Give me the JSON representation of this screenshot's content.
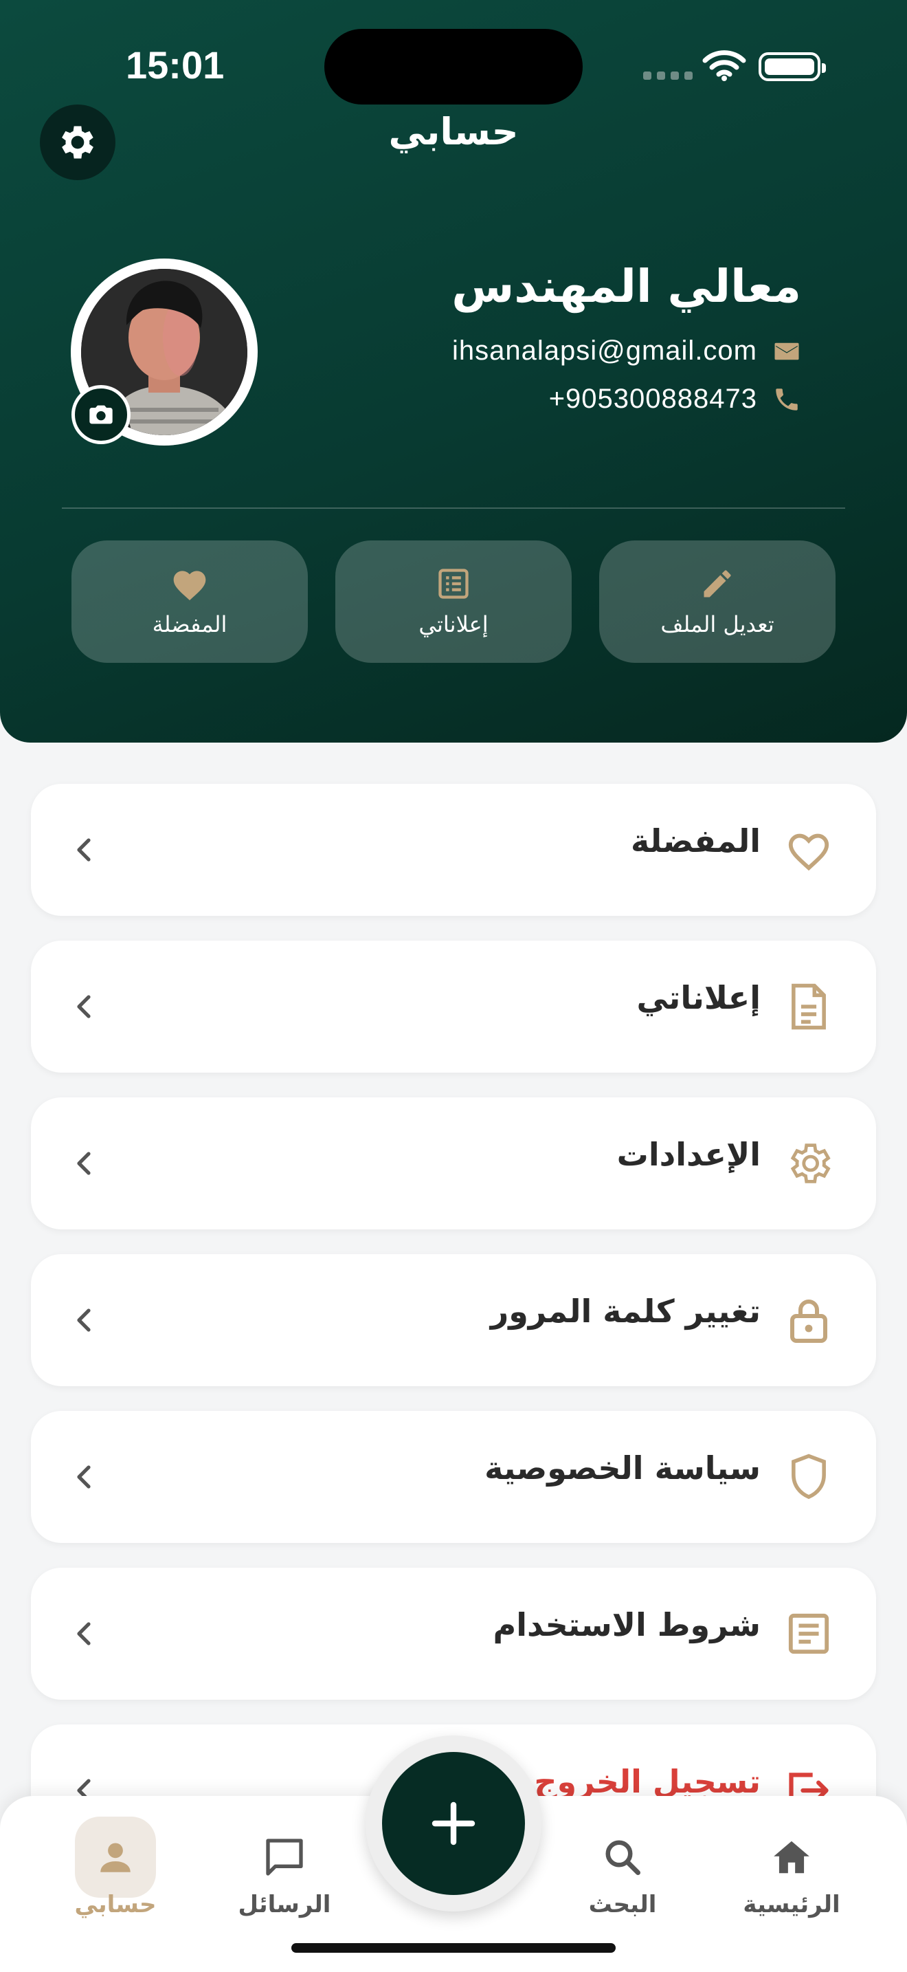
{
  "status_bar": {
    "time": "15:01"
  },
  "header": {
    "title": "حسابي"
  },
  "profile": {
    "name": "معالي المهندس",
    "email": "ihsanalapsi@gmail.com",
    "phone": "+905300888473"
  },
  "quick_actions": [
    {
      "label": "المفضلة",
      "icon": "heart-icon"
    },
    {
      "label": "إعلاناتي",
      "icon": "list-icon"
    },
    {
      "label": "تعديل الملف",
      "icon": "pencil-icon"
    }
  ],
  "menu": [
    {
      "label": "المفضلة",
      "icon": "heart-outline-icon"
    },
    {
      "label": "إعلاناتي",
      "icon": "document-icon"
    },
    {
      "label": "الإعدادات",
      "icon": "gear-icon"
    },
    {
      "label": "تغيير كلمة المرور",
      "icon": "lock-icon"
    },
    {
      "label": "سياسة الخصوصية",
      "icon": "shield-icon"
    },
    {
      "label": "شروط الاستخدام",
      "icon": "terms-icon"
    },
    {
      "label": "تسجيل الخروج",
      "icon": "logout-icon"
    }
  ],
  "bottom_nav": [
    {
      "label": "حسابي",
      "icon": "person-icon",
      "active": true
    },
    {
      "label": "الرسائل",
      "icon": "chat-icon",
      "active": false
    },
    {
      "label": "البحث",
      "icon": "search-icon",
      "active": false
    },
    {
      "label": "الرئيسية",
      "icon": "home-icon",
      "active": false
    }
  ],
  "colors": {
    "header_green": "#083a31",
    "accent_gold": "#c2a57c",
    "logout_red": "#d9403a"
  }
}
